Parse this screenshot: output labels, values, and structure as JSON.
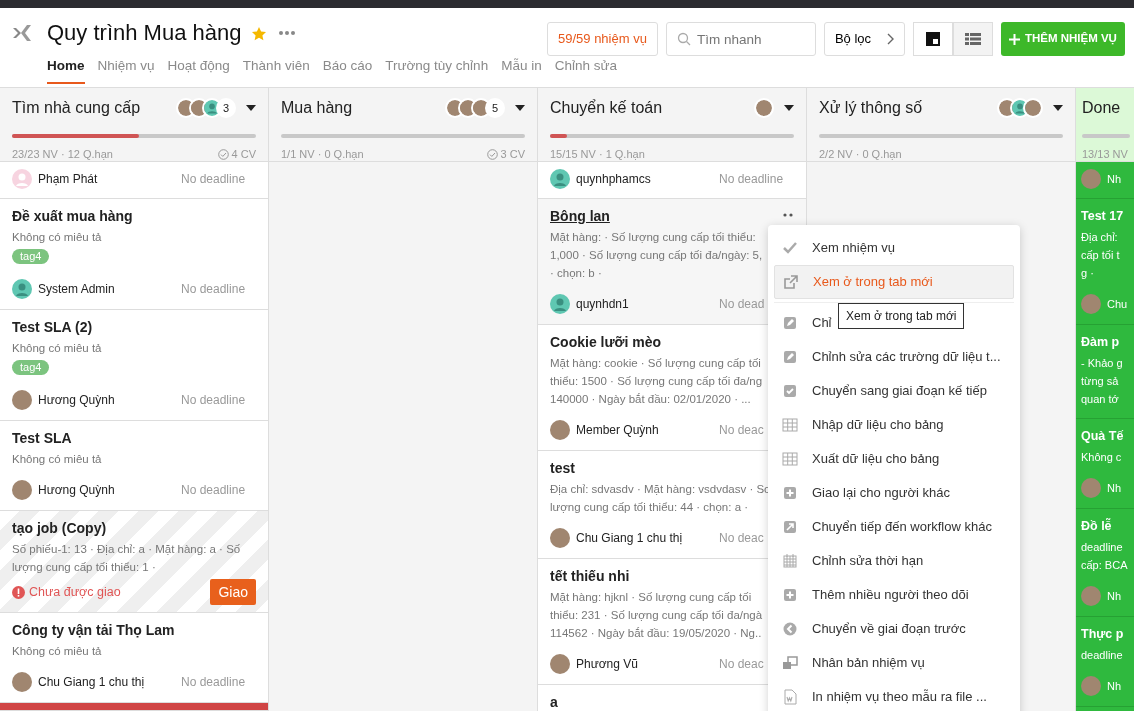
{
  "app": {
    "title": "Quy trình Mua hàng",
    "starred": true
  },
  "nav_tabs": [
    {
      "label": "Home",
      "selected": true
    },
    {
      "label": "Nhiệm vụ",
      "selected": false
    },
    {
      "label": "Hoạt động",
      "selected": false
    },
    {
      "label": "Thành viên",
      "selected": false
    },
    {
      "label": "Báo cáo",
      "selected": false
    },
    {
      "label": "Trường tùy chỉnh",
      "selected": false
    },
    {
      "label": "Mẫu in",
      "selected": false
    },
    {
      "label": "Chỉnh sửa",
      "selected": false
    }
  ],
  "toolbar": {
    "task_count": "59/59 nhiệm vụ",
    "search": {
      "placeholder": "Tìm nhanh"
    },
    "filter": "Bộ lọc",
    "views": [
      {
        "kind": "board",
        "selected": true
      },
      {
        "kind": "list",
        "selected": false
      }
    ],
    "add_button": "THÊM NHIỆM VỤ"
  },
  "columns": [
    {
      "kind": "stage",
      "title": "Tìm nhà cung cấp",
      "members": [
        {
          "kind": "photo"
        },
        {
          "kind": "photo"
        },
        {
          "kind": "person"
        }
      ],
      "member_count": "3",
      "level": 0.52,
      "stats": "23/23 NV · 12 Q.hạn",
      "done_count": "4 CV",
      "cards": [
        {
          "assignee": {
            "name": "Phạm Phát",
            "kind": "blank"
          },
          "deadline": "No deadline"
        },
        {
          "title": "Đề xuất mua hàng",
          "description": [
            "Không có miêu tả"
          ],
          "tags": [
            "tag4"
          ],
          "assignee": {
            "name": "System Admin",
            "kind": "person"
          },
          "deadline": "No deadline"
        },
        {
          "title": "Test SLA (2)",
          "description": [
            "Không có miêu tả"
          ],
          "tags": [
            "tag4"
          ],
          "assignee": {
            "name": "Hương Quỳnh",
            "kind": "photo"
          },
          "deadline": "No deadline"
        },
        {
          "title": "Test SLA",
          "description": [
            "Không có miêu tả"
          ],
          "assignee": {
            "name": "Hương Quỳnh",
            "kind": "photo"
          },
          "deadline": "No deadline"
        },
        {
          "title": "tạo job (Copy)",
          "striped": true,
          "description": [
            "Số phiếu-1: 13 · Địa chỉ: a · Mặt hàng: a · Số",
            "lượng cung cấp tối thiểu: 1 ·"
          ],
          "warning": "Chưa được giao",
          "assign_button": "Giao"
        },
        {
          "title": "Công ty vận tải Thọ Lam",
          "description": [
            "Không có miêu tả"
          ],
          "assignee": {
            "name": "Chu Giang 1 chu thị",
            "kind": "photo"
          },
          "deadline": "No deadline"
        },
        {
          "overdue": true
        }
      ]
    },
    {
      "kind": "stage",
      "title": "Mua hàng",
      "members": [
        {
          "kind": "photo"
        },
        {
          "kind": "photo"
        },
        {
          "kind": "photo"
        }
      ],
      "member_count": "5",
      "level": 0,
      "stats": "1/1 NV · 0 Q.hạn",
      "done_count": "3 CV"
    },
    {
      "kind": "stage",
      "title": "Chuyển kế toán",
      "members": [
        {
          "kind": "photo"
        }
      ],
      "level": 0.07,
      "stats": "15/15 NV · 1 Q.hạn",
      "cards": [
        {
          "assignee": {
            "name": "quynhphamcs",
            "kind": "person"
          },
          "deadline": "No deadline"
        },
        {
          "title": "Bông lan",
          "hovered": true,
          "description": [
            "Mặt hàng: · Số lượng cung cấp tối thiểu:",
            "1,000 · Số lượng cung cấp tối đa/ngày: 5,",
            "· chọn: b ·"
          ],
          "assignee": {
            "name": "quynhdn1",
            "kind": "person"
          },
          "deadline": "No dead"
        },
        {
          "title": "Cookie lưỡi mèo",
          "description": [
            "Mặt hàng: cookie · Số lượng cung cấp tối",
            "thiểu: 1500 · Số lượng cung cấp tối đa/ng",
            "140000 · Ngày bắt đầu: 02/01/2020 · ..."
          ],
          "assignee": {
            "name": "Member Quỳnh",
            "kind": "photo"
          },
          "deadline": "No deac"
        },
        {
          "title": "test",
          "description": [
            "Địa chỉ: sdvasdv · Mặt hàng: vsdvdasv · Sc",
            "lượng cung cấp tối thiểu: 44 · chọn: a ·"
          ],
          "assignee": {
            "name": "Chu Giang 1 chu thị",
            "kind": "photo"
          },
          "deadline": "No deac"
        },
        {
          "title": "tết thiếu nhi",
          "description": [
            "Mặt hàng: hjknl · Số lượng cung cấp tối",
            "thiểu: 231 · Số lượng cung cấp tối đa/ngà",
            "114562 · Ngày bắt đầu: 19/05/2020 · Ng.."
          ],
          "assignee": {
            "name": "Phương Vũ",
            "kind": "photo"
          },
          "deadline": "No deac"
        },
        {
          "title": "a"
        }
      ]
    },
    {
      "kind": "stage",
      "title": "Xử lý thông số",
      "members": [
        {
          "kind": "photo"
        },
        {
          "kind": "person"
        },
        {
          "kind": "photo"
        }
      ],
      "level": 0,
      "stats": "2/2 NV · 0 Q.hạn"
    },
    {
      "kind": "done",
      "title": "Done",
      "level": 0,
      "stats": "13/13 NV",
      "cards": [
        {
          "assignee": {
            "name": "Nh",
            "kind": "photo"
          }
        },
        {
          "title": "Test 17",
          "description": [
            "Địa chỉ:",
            "cấp tối t",
            "g ·"
          ],
          "assignee": {
            "name": "Chu",
            "kind": "photo"
          }
        },
        {
          "title": "Đàm p",
          "description": [
            "- Khảo g",
            "từng sả",
            "quan tớ"
          ]
        },
        {
          "title": "Quà Tế",
          "description": [
            "Không c"
          ],
          "assignee": {
            "name": "Nh",
            "kind": "photo"
          }
        },
        {
          "title": "Đồ lễ",
          "description": [
            "deadline",
            "cấp: BCA"
          ],
          "assignee": {
            "name": "Nh",
            "kind": "photo"
          }
        },
        {
          "title": "Thực p",
          "description": [
            "deadline"
          ],
          "assignee": {
            "name": "Nh",
            "kind": "photo"
          }
        }
      ]
    }
  ],
  "context_menu": {
    "items": [
      {
        "label": "Xem nhiệm vụ",
        "kind": "check",
        "selected": false
      },
      {
        "label": "Xem ở trong tab mới",
        "kind": "external",
        "selected": true
      },
      {
        "label": "Chỉ",
        "kind": "pencil",
        "selected": false
      },
      {
        "label": "Chỉnh sửa các trường dữ liệu t...",
        "kind": "pencil",
        "selected": false
      },
      {
        "label": "Chuyển sang giai đoạn kế tiếp",
        "kind": "checkbox",
        "selected": false
      },
      {
        "label": "Nhập dữ liệu cho bảng",
        "kind": "table",
        "selected": false
      },
      {
        "label": "Xuất dữ liệu cho bảng",
        "kind": "table",
        "selected": false
      },
      {
        "label": "Giao lại cho người khác",
        "kind": "plus",
        "selected": false
      },
      {
        "label": "Chuyển tiếp đến workflow khác",
        "kind": "forward",
        "selected": false
      },
      {
        "label": "Chỉnh sửa thời hạn",
        "kind": "calendar",
        "selected": false
      },
      {
        "label": "Thêm nhiều người theo dõi",
        "kind": "plus",
        "selected": false
      },
      {
        "label": "Chuyển về giai đoạn trước",
        "kind": "back",
        "selected": false
      },
      {
        "label": "Nhân bản nhiệm vụ",
        "kind": "copy",
        "selected": false
      },
      {
        "label": "In nhiệm vụ theo mẫu ra file ...",
        "kind": "word",
        "selected": false
      }
    ]
  },
  "tooltip": "Xem ở trong tab mới"
}
